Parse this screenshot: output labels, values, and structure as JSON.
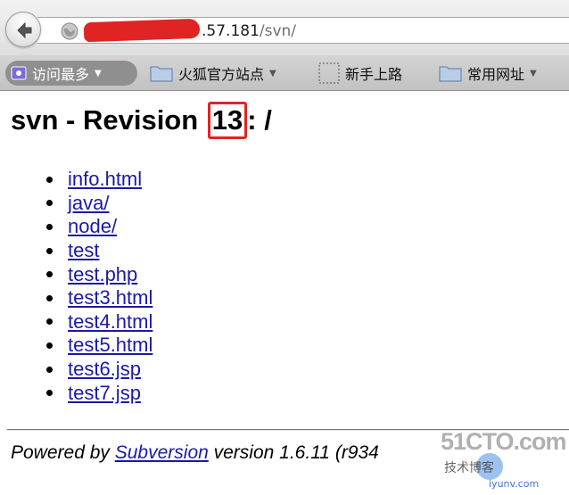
{
  "browser": {
    "url_host": ".57.181",
    "url_path": "/svn/"
  },
  "bookmarks": {
    "most_visited": "访问最多",
    "firefox_sites": "火狐官方站点",
    "getting_started": "新手上路",
    "common_sites": "常用网址"
  },
  "page": {
    "title_prefix": "svn - Revision ",
    "revision": "13",
    "title_suffix": ": /",
    "files": [
      "info.html",
      "java/",
      "node/",
      "test",
      "test.php",
      "test3.html",
      "test4.html",
      "test5.html",
      "test6.jsp",
      "test7.jsp"
    ],
    "footer_prefix": "Powered by ",
    "footer_link": "Subversion",
    "footer_suffix": " version 1.6.11 (r934"
  },
  "watermark": {
    "main": "51CTO.com",
    "sub1": "技术博客",
    "sub2": "iyunv.com"
  },
  "colors": {
    "link": "#1a1aa6",
    "highlight": "#e02424"
  }
}
